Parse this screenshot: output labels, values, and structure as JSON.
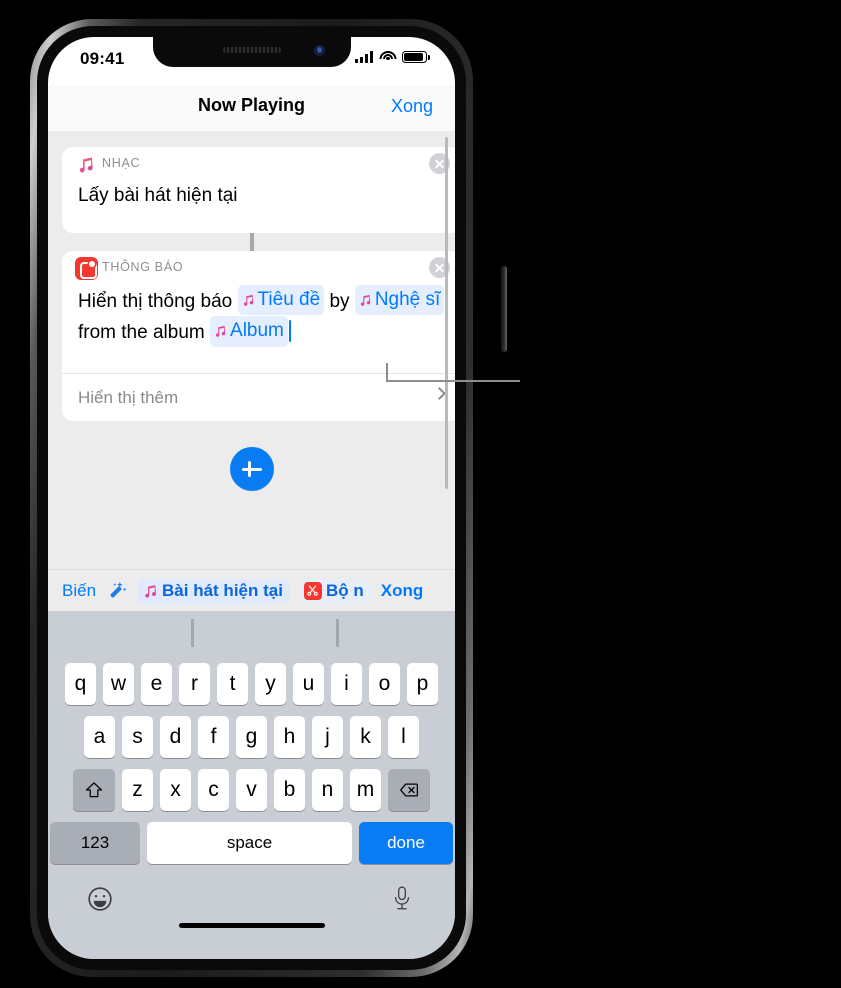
{
  "status_bar": {
    "time": "09:41",
    "signal_icon": "cellular-signal-icon",
    "wifi_icon": "wifi-icon",
    "battery_icon": "battery-icon"
  },
  "nav_bar": {
    "title": "Now Playing",
    "done_label": "Xong"
  },
  "cards": [
    {
      "kind": "NHẠC",
      "icon": "music-app-icon",
      "body_text": "Lấy bài hát hiện tại",
      "remove_label": "x"
    },
    {
      "kind": "THÔNG BÁO",
      "icon": "notification-app-icon",
      "text_before": "Hiển thị thông báo",
      "token_1": "Tiêu đề",
      "text_mid_1": "by",
      "token_2": "Nghệ sĩ",
      "text_mid_2": "from the album",
      "token_3": "Album",
      "show_more_label": "Hiển thị thêm"
    }
  ],
  "add_button": {
    "label": "+",
    "icon": "plus-icon",
    "color": "#0a7cf3"
  },
  "accessory_bar": {
    "variables_label": "Biến",
    "wand_icon": "magic-wand-icon",
    "token_current_song": "Bài hát hiện tại",
    "token_shortcut_input": "Bộ n",
    "done_label": "Xong"
  },
  "keyboard": {
    "row1": [
      "q",
      "w",
      "e",
      "r",
      "t",
      "y",
      "u",
      "i",
      "o",
      "p"
    ],
    "row2": [
      "a",
      "s",
      "d",
      "f",
      "g",
      "h",
      "j",
      "k",
      "l"
    ],
    "row3_letters": [
      "z",
      "x",
      "c",
      "v",
      "b",
      "n",
      "m"
    ],
    "shift_icon": "shift-icon",
    "backspace_icon": "backspace-icon",
    "numbers_label": "123",
    "space_label": "space",
    "done_label": "done",
    "emoji_icon": "emoji-icon",
    "dictation_icon": "microphone-icon"
  },
  "colors": {
    "accent_blue": "#007aff",
    "button_blue": "#0a7cf3",
    "notification_red": "#f5382f",
    "token_bg": "#e5eefc",
    "keyboard_bg": "#c9cdd4"
  }
}
